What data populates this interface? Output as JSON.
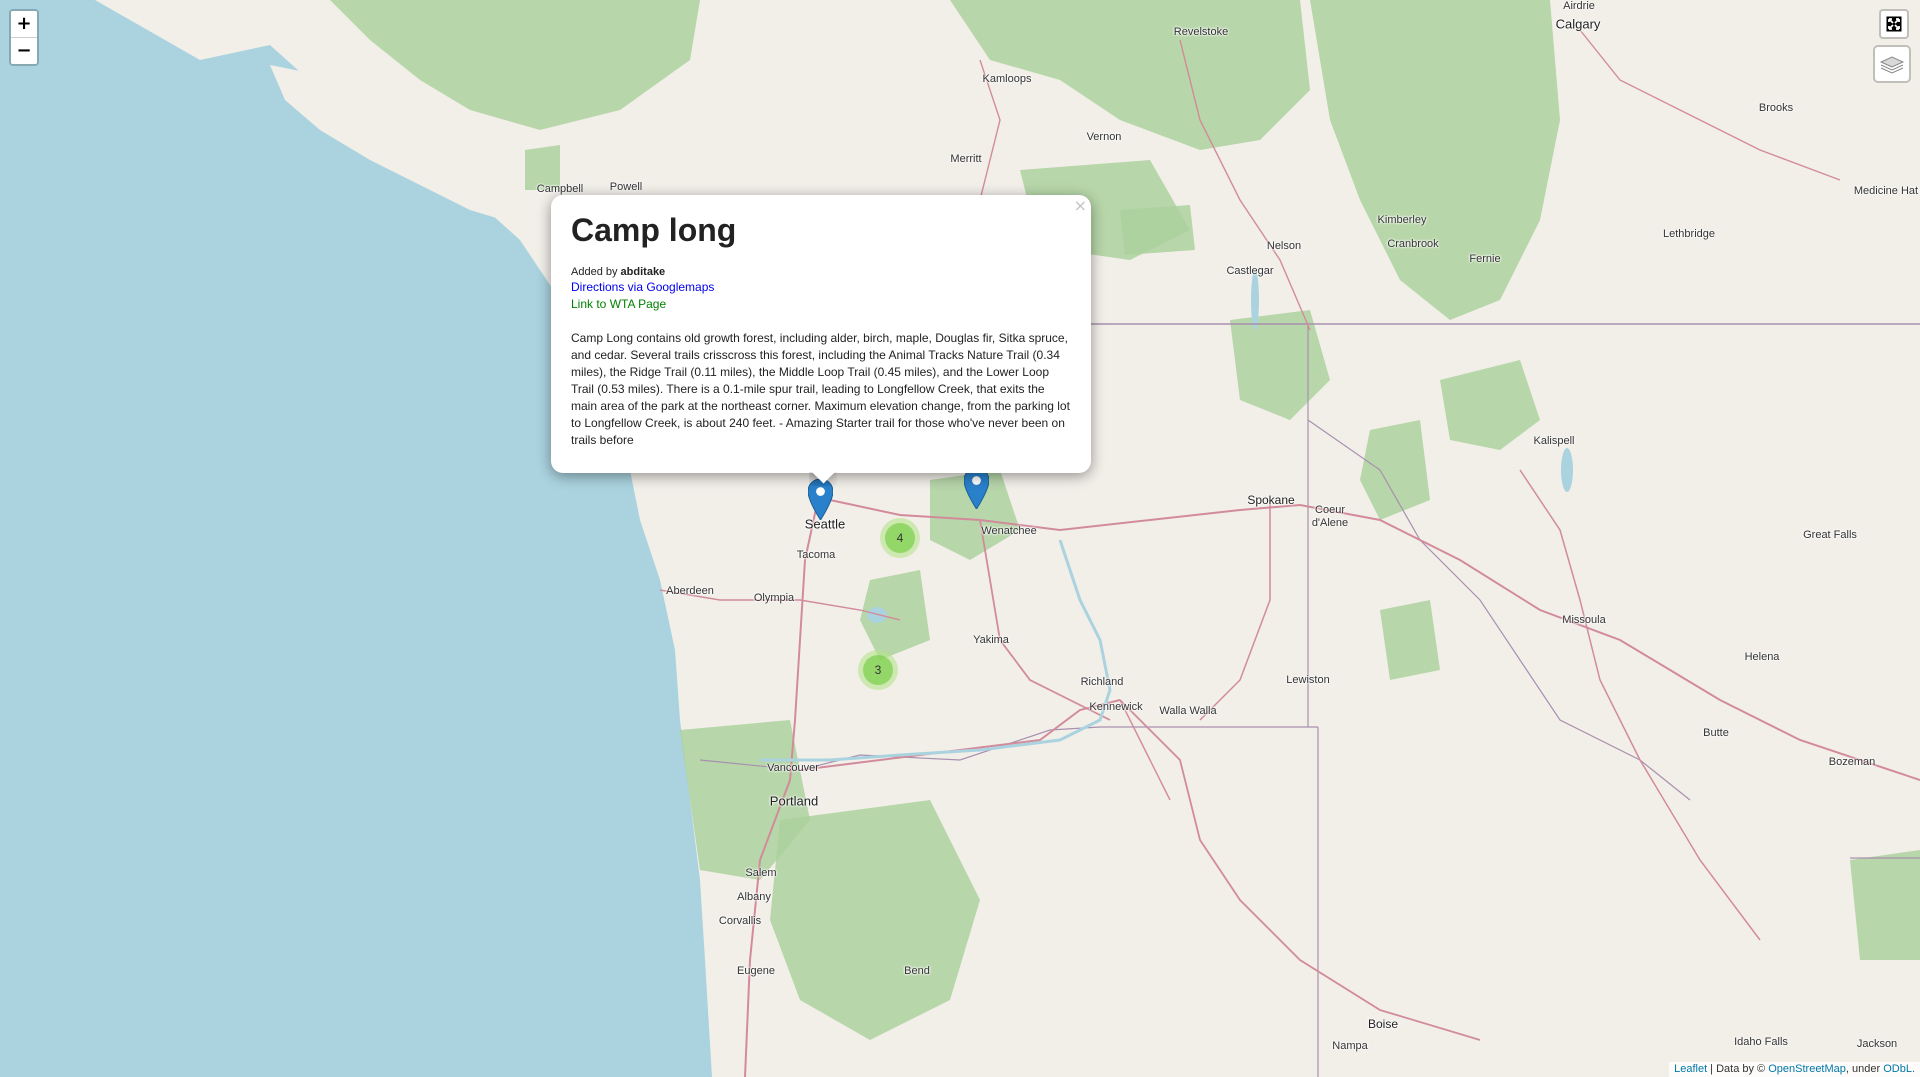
{
  "controls": {
    "zoom_in": "+",
    "zoom_out": "−"
  },
  "popup": {
    "title": "Camp long",
    "added_by_prefix": "Added by",
    "added_by_user": "abditake",
    "directions_link": "Directions via Googlemaps",
    "wta_link": "Link to WTA Page",
    "close_symbol": "×",
    "description": "Camp Long contains old growth forest, including alder, birch, maple, Douglas fir, Sitka spruce, and cedar. Several trails crisscross this forest, including the Animal Tracks Nature Trail (0.34 miles), the Ridge Trail (0.11 miles), the Middle Loop Trail (0.45 miles), and the Lower Loop Trail (0.53 miles). There is a 0.1-mile spur trail, leading to Longfellow Creek, that exits the main area of the park at the northeast corner. Maximum elevation change, from the parking lot to Longfellow Creek, is about 240 feet. - Amazing Starter trail for those who've never been on trails before"
  },
  "clusters": [
    {
      "count": "4"
    },
    {
      "count": "3"
    }
  ],
  "attribution": {
    "leaflet": "Leaflet",
    "separator": " | Data by © ",
    "osm": "OpenStreetMap",
    "under": ", under ",
    "license": "ODbL."
  },
  "places": {
    "airdrie": "Airdrie",
    "calgary": "Calgary",
    "revelstoke": "Revelstoke",
    "kamloops": "Kamloops",
    "vernon": "Vernon",
    "merritt": "Merritt",
    "brooks": "Brooks",
    "medicine_hat": "Medicine Hat",
    "campbell": "Campbell",
    "powell": "Powell",
    "kimberley": "Kimberley",
    "cranbrook": "Cranbrook",
    "fernie": "Fernie",
    "lethbridge": "Lethbridge",
    "nelson": "Nelson",
    "castlegar": "Castlegar",
    "kalispell": "Kalispell",
    "spokane": "Spokane",
    "coeur_dalene": "Coeur d'Alene",
    "great_falls": "Great Falls",
    "wenatchee": "Wenatchee",
    "seattle": "Seattle",
    "tacoma": "Tacoma",
    "aberdeen": "Aberdeen",
    "olympia": "Olympia",
    "yakima": "Yakima",
    "missoula": "Missoula",
    "helena": "Helena",
    "richland": "Richland",
    "kennewick": "Kennewick",
    "walla_walla": "Walla Walla",
    "lewiston": "Lewiston",
    "butte": "Butte",
    "bozeman": "Bozeman",
    "vancouver": "Vancouver",
    "portland": "Portland",
    "salem": "Salem",
    "albany": "Albany",
    "corvallis": "Corvallis",
    "eugene": "Eugene",
    "bend": "Bend",
    "boise": "Boise",
    "nampa": "Nampa",
    "idaho_falls": "Idaho Falls",
    "jackson": "Jackson"
  }
}
